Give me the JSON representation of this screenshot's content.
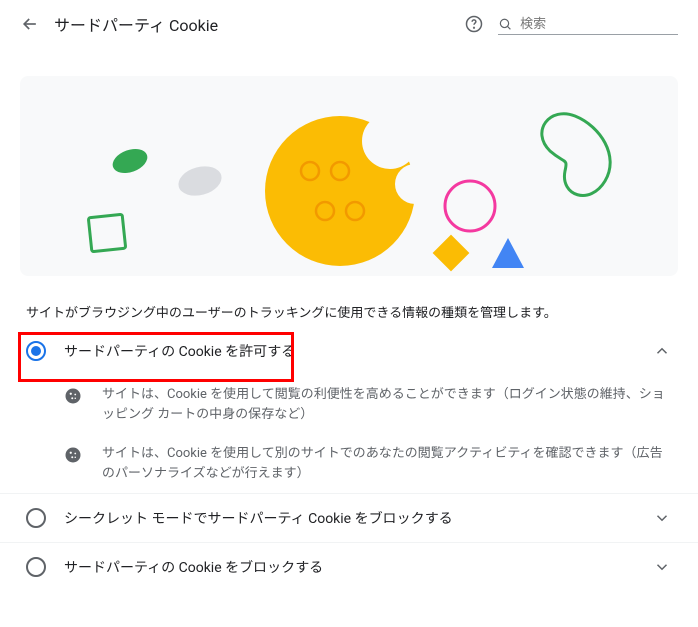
{
  "header": {
    "title": "サードパーティ Cookie",
    "search_placeholder": "検索"
  },
  "description": "サイトがブラウジング中のユーザーのトラッキングに使用できる情報の種類を管理します。",
  "options": [
    {
      "label": "サードパーティの Cookie を許可する",
      "selected": true,
      "expanded": true
    },
    {
      "label": "シークレット モードでサードパーティ Cookie をブロックする",
      "selected": false,
      "expanded": false
    },
    {
      "label": "サードパーティの Cookie をブロックする",
      "selected": false,
      "expanded": false
    }
  ],
  "sub_items": [
    "サイトは、Cookie を使用して閲覧の利便性を高めることができます（ログイン状態の維持、ショッピング カートの中身の保存など）",
    "サイトは、Cookie を使用して別のサイトでのあなたの閲覧アクティビティを確認できます（広告のパーソナライズなどが行えます）"
  ]
}
